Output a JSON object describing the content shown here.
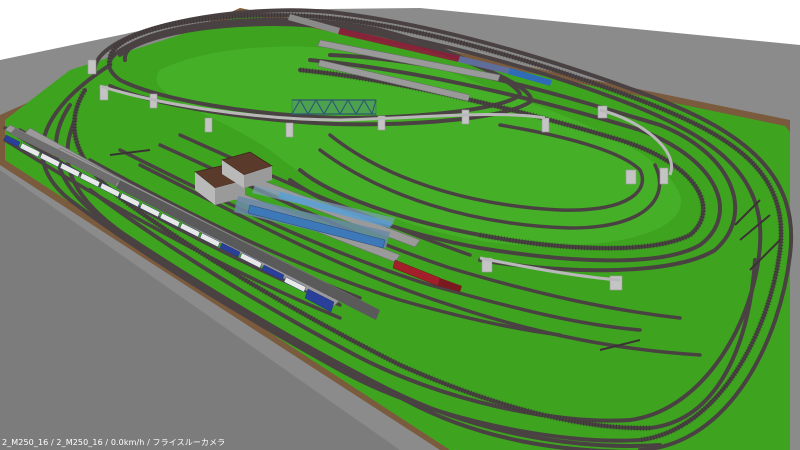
{
  "status_bar": {
    "text": "2_M250_16 / 2_M250_16 / 0.0km/h / フライスルーカメラ"
  },
  "scene": {
    "sky_color": "#ffffff",
    "ground_gray": "#8a8a8a",
    "baseboard_green": "#3fa521",
    "border_brown": "#7a5a3c",
    "track_color": "#4a4242",
    "viaduct_color": "#b9b9b9"
  }
}
